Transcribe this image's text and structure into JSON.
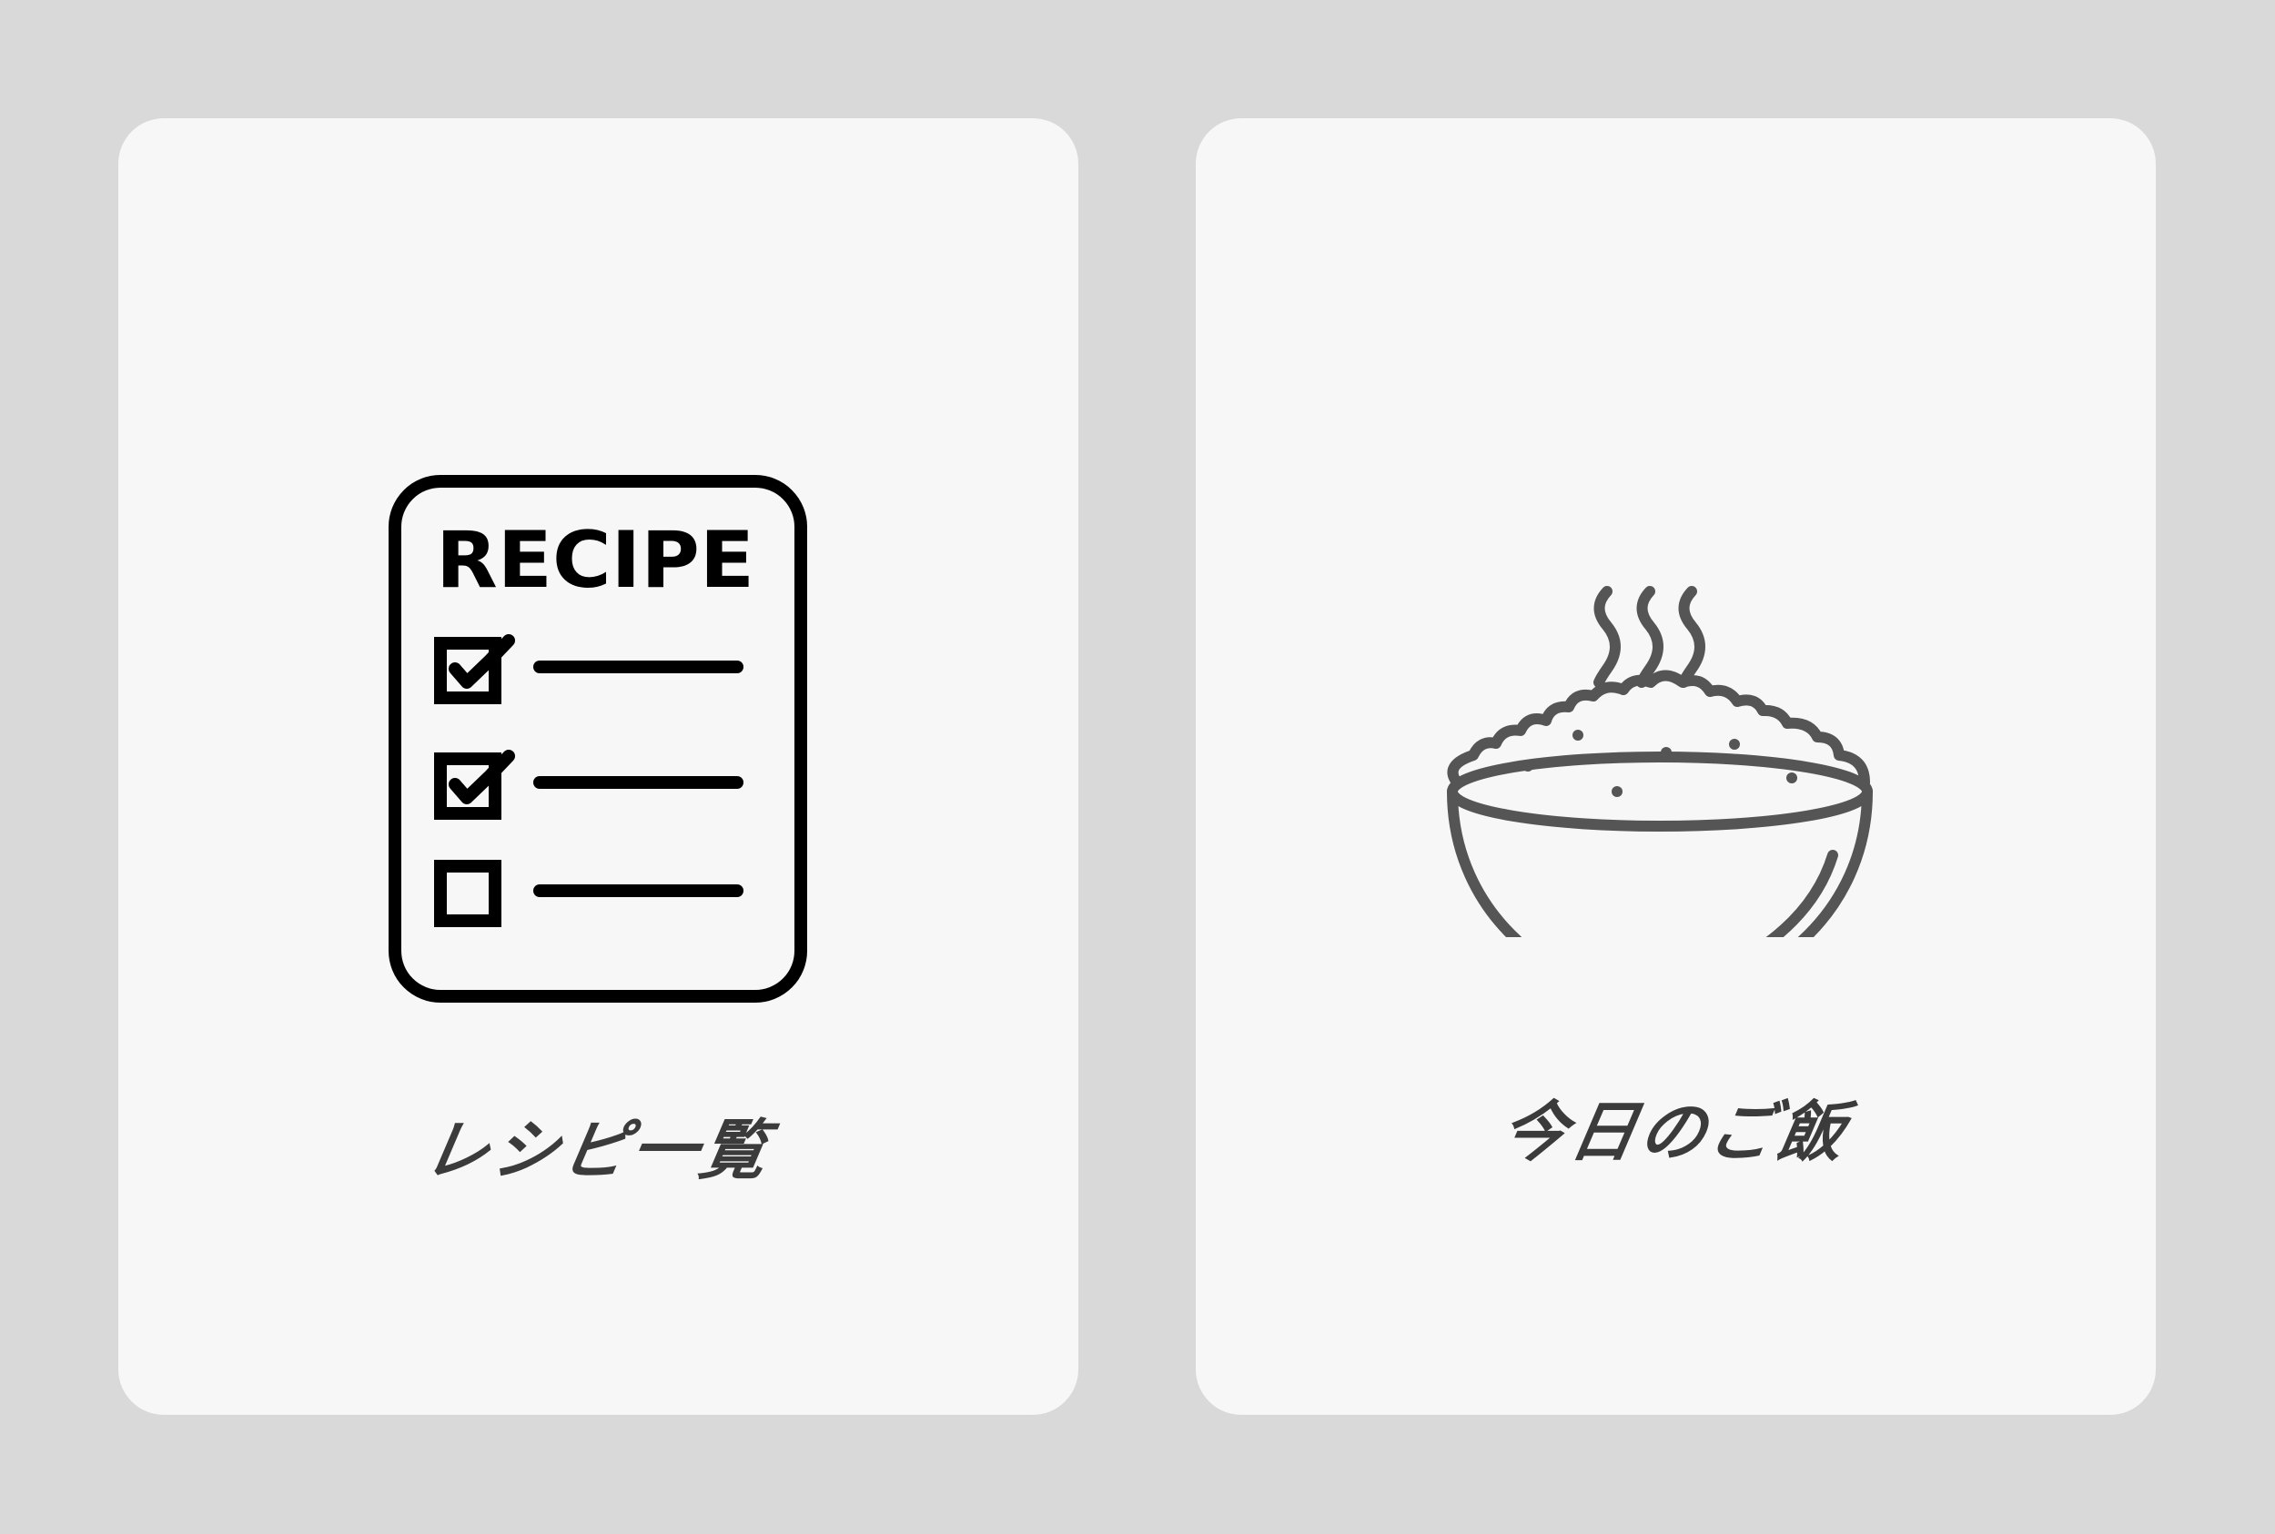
{
  "cards": [
    {
      "label": "レシピ一覧",
      "icon": "recipe-checklist-icon",
      "icon_title": "RECIPE",
      "icon_color": "#000000"
    },
    {
      "label": "今日のご飯",
      "icon": "rice-bowl-icon",
      "icon_color": "#555555"
    }
  ],
  "colors": {
    "background": "#d9d9d9",
    "card": "#f7f7f7",
    "label": "#3b3b3b"
  }
}
